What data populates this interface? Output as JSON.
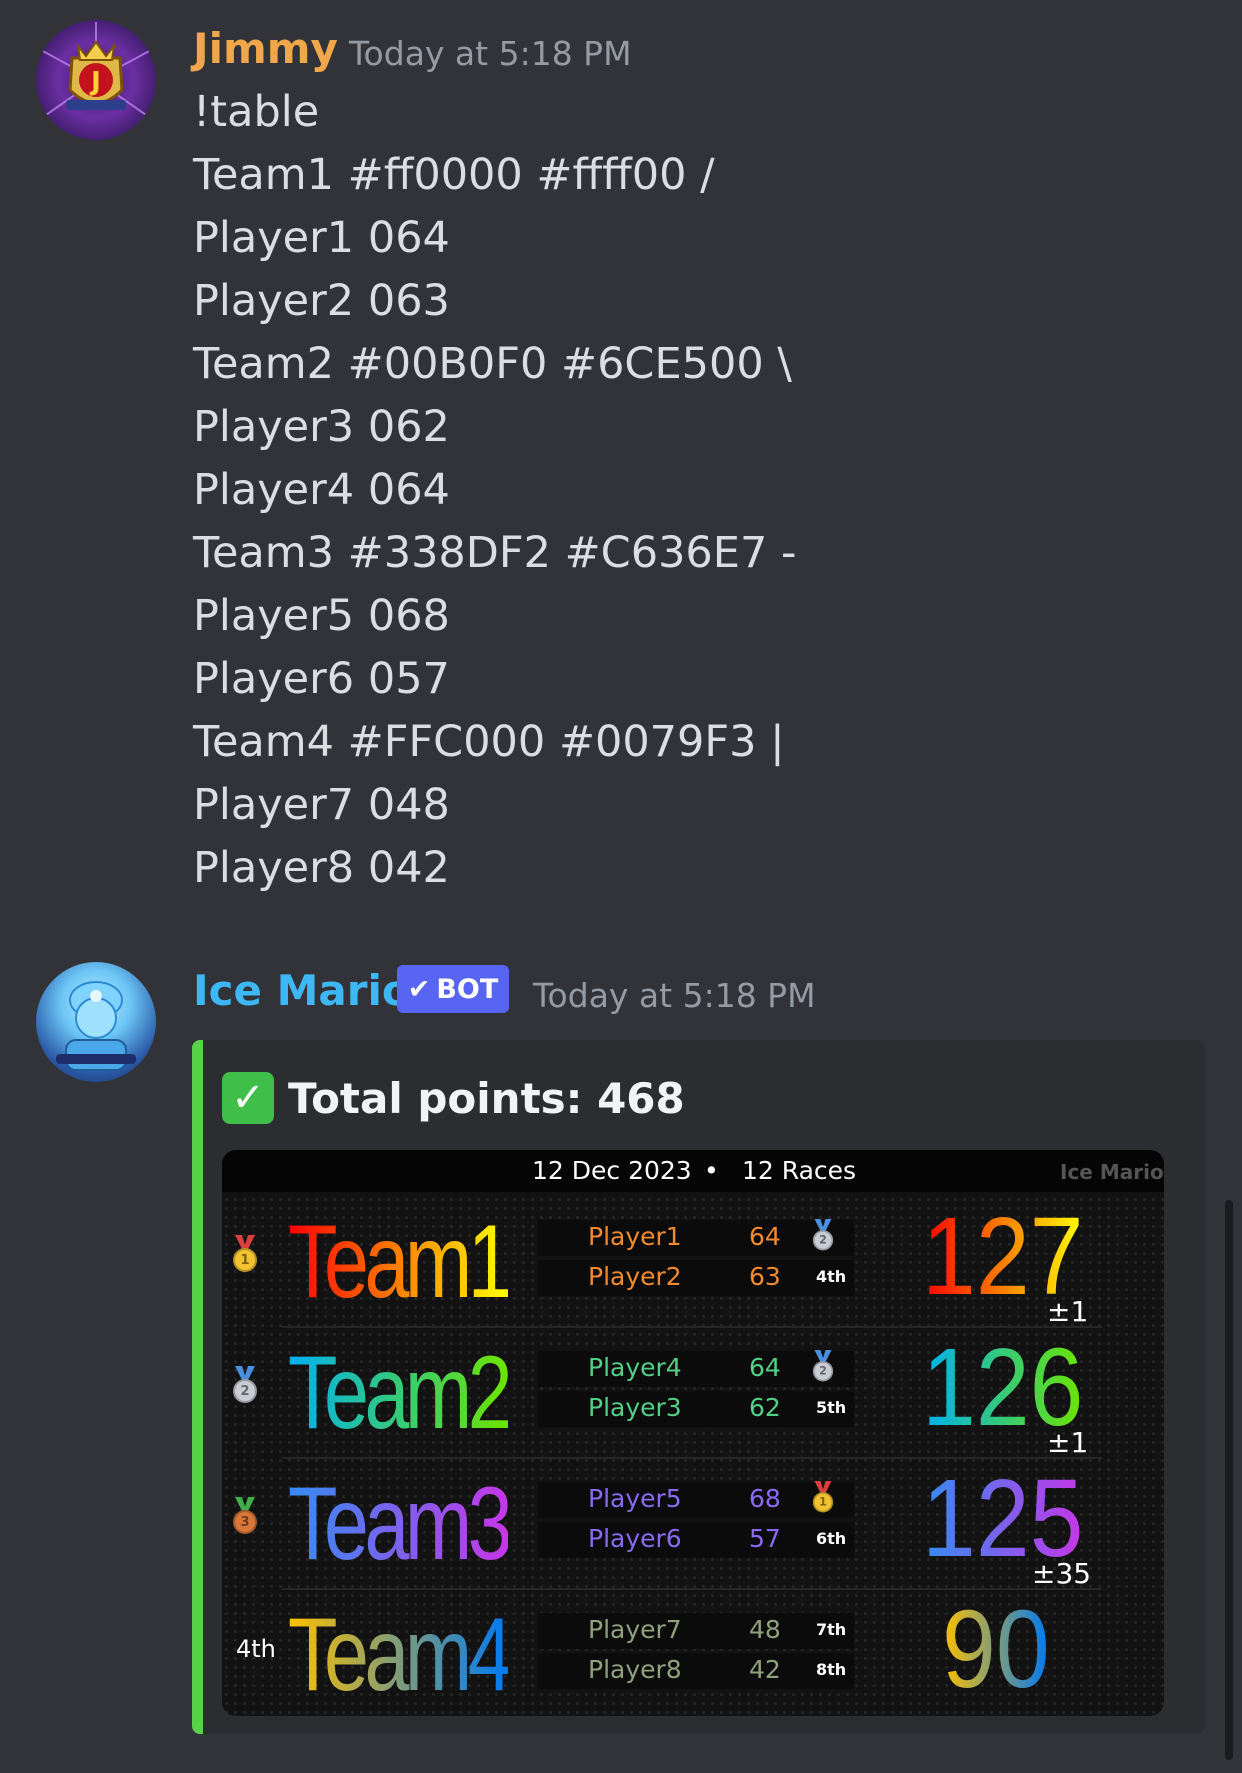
{
  "messages": [
    {
      "author": "Jimmy",
      "timestamp": "Today at 5:18 PM",
      "lines": [
        "!table",
        "Team1 #ff0000 #ffff00 /",
        "Player1 064",
        "Player2 063",
        "Team2 #00B0F0 #6CE500 \\",
        "Player3 062",
        "Player4 064",
        "Team3 #338DF2 #C636E7 -",
        "Player5 068",
        "Player6 057",
        "Team4 #FFC000 #0079F3 |",
        "Player7 048",
        "Player8 042"
      ],
      "name_color": "#f0a64a"
    },
    {
      "author": "Ice Mario",
      "bot_badge": "BOT",
      "timestamp": "Today at 5:18 PM",
      "name_color": "#3db8f5"
    }
  ],
  "embed": {
    "title": "Total points: 468",
    "accent": "#5ad14a",
    "table": {
      "date": "12 Dec 2023",
      "separator": "•",
      "races": "12 Races",
      "watermark": "Ice Mario",
      "teams": [
        {
          "name": "Team1",
          "rank": "1",
          "rank_label": "",
          "total": "127",
          "diff": "±1",
          "color1": "#ff0000",
          "color2": "#ffff00",
          "players": [
            {
              "name": "Player1",
              "score": "64",
              "pos": "",
              "medal": "2"
            },
            {
              "name": "Player2",
              "score": "63",
              "pos": "4th",
              "medal": ""
            }
          ],
          "player_color": "#f28a2e"
        },
        {
          "name": "Team2",
          "rank": "2",
          "rank_label": "",
          "total": "126",
          "diff": "±1",
          "color1": "#00B0F0",
          "color2": "#6CE500",
          "players": [
            {
              "name": "Player4",
              "score": "64",
              "pos": "",
              "medal": "2"
            },
            {
              "name": "Player3",
              "score": "62",
              "pos": "5th",
              "medal": ""
            }
          ],
          "player_color": "#52d085"
        },
        {
          "name": "Team3",
          "rank": "3",
          "rank_label": "",
          "total": "125",
          "diff": "±35",
          "color1": "#338DF2",
          "color2": "#C636E7",
          "players": [
            {
              "name": "Player5",
              "score": "68",
              "pos": "",
              "medal": "1"
            },
            {
              "name": "Player6",
              "score": "57",
              "pos": "6th",
              "medal": ""
            }
          ],
          "player_color": "#8a6af0"
        },
        {
          "name": "Team4",
          "rank": "",
          "rank_label": "4th",
          "total": "90",
          "diff": "",
          "color1": "#FFC000",
          "color2": "#0079F3",
          "players": [
            {
              "name": "Player7",
              "score": "48",
              "pos": "7th",
              "medal": ""
            },
            {
              "name": "Player8",
              "score": "42",
              "pos": "8th",
              "medal": ""
            }
          ],
          "player_color": "#8fa27c"
        }
      ]
    }
  }
}
